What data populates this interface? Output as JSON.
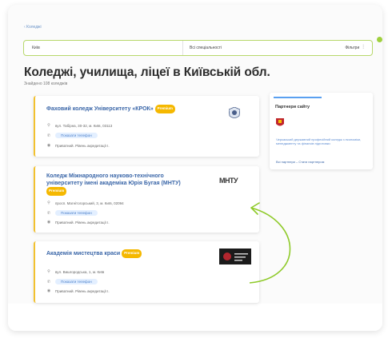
{
  "breadcrumb": "‹ Коледжі",
  "search": {
    "city": "Київ",
    "specialty": "Всі спеціальності",
    "filter_label": "Фільтри"
  },
  "page": {
    "title": "Коледжі, училища, ліцеї в Київській обл.",
    "found": "Знайдено 108 коледжів"
  },
  "cards": [
    {
      "title": "Фаховий коледж Університету «КРОК»",
      "badge": "Premium",
      "address": "вул. Табірна, 30-32, м. Київ, 03113",
      "phone_button": "Показати телефон",
      "info": "Приватний. Рівень акредитації I."
    },
    {
      "title_line1": "Коледж Міжнародного науково-технічного",
      "title_line2": "університету імені академіка Юрія Бугая (МНТУ)",
      "badge": "Premium",
      "logo_text": "МНТУ",
      "address": "просп. Магнітогорський, 3, м. Київ, 02094",
      "phone_button": "Показати телефон",
      "info": "Приватний. Рівень акредитації I."
    },
    {
      "title": "Академія мистецтва краси",
      "badge": "Premium",
      "address": "вул. Вишгородська, 1, м. Київ",
      "phone_button": "Показати телефон",
      "info": "Приватний. Рівень акредитації I."
    }
  ],
  "sidebar": {
    "title": "Партнери сайту",
    "partner_text": "Черкаський державний професійний коледж з економіки, менеджменту та фінансів підготовки",
    "link": "Всі партнери – Стати партнером"
  },
  "colors": {
    "accent": "#9fd03d",
    "link": "#3a66a8",
    "badge": "#f5b800"
  }
}
